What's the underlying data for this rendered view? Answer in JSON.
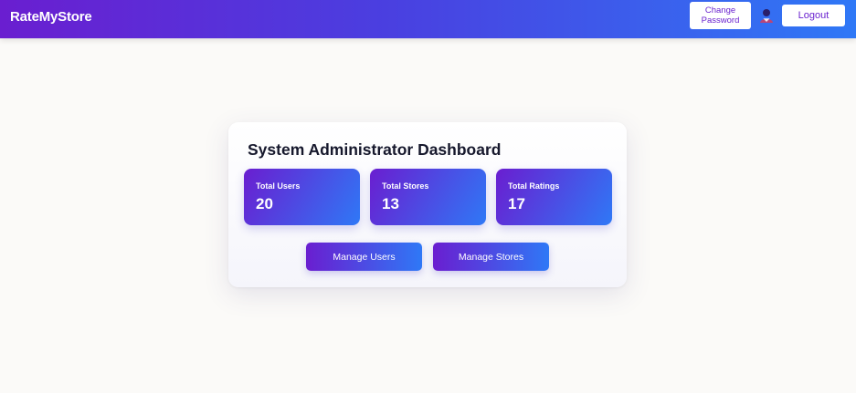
{
  "header": {
    "brand": "RateMyStore",
    "change_password_line1": "Change",
    "change_password_line2": "Password",
    "avatar_icon": "user-icon",
    "logout_label": "Logout"
  },
  "dashboard": {
    "title": "System Administrator Dashboard",
    "stats": [
      {
        "label": "Total Users",
        "value": "20"
      },
      {
        "label": "Total Stores",
        "value": "13"
      },
      {
        "label": "Total Ratings",
        "value": "17"
      }
    ],
    "actions": {
      "manage_users_label": "Manage Users",
      "manage_stores_label": "Manage Stores"
    }
  },
  "colors": {
    "gradient_start": "#6a1ed0",
    "gradient_end": "#2f78f6",
    "accent_text": "#6a22cf",
    "page_background": "#fbfaf8"
  }
}
